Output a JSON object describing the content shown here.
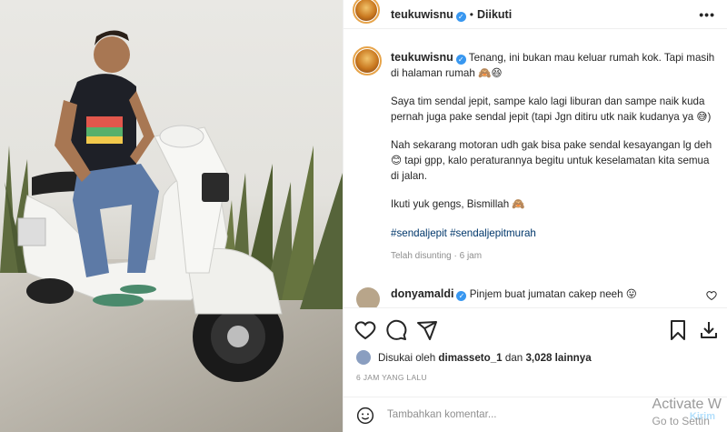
{
  "header": {
    "username": "teukuwisnu",
    "separator": "•",
    "follow_status": "Diikuti",
    "more_icon": "more-horizontal-icon"
  },
  "caption": {
    "username": "teukuwisnu",
    "paragraphs": [
      "Tenang, ini bukan mau keluar rumah kok. Tapi masih di halaman rumah 🙈😆",
      "Saya tim sendal jepit, sampe kalo lagi liburan dan sampe naik kuda pernah juga pake sendal jepit (tapi Jgn ditiru utk naik kudanya ya 😅)",
      "Nah sekarang motoran udh gak bisa pake sendal kesayangan lg deh 😊 tapi gpp, kalo peraturannya begitu untuk keselamatan kita semua di jalan.",
      "Ikuti yuk gengs, Bismillah 🙈"
    ],
    "hashtags": "#sendaljepit #sendaljepitmurah",
    "time": "Telah disunting · 6 jam"
  },
  "comment": {
    "username": "donyamaldi",
    "text": "Pinjem buat jumatan cakep neeh 😛"
  },
  "actions": {
    "like_icon": "heart-icon",
    "comment_icon": "comment-icon",
    "share_icon": "share-icon",
    "save_icon": "bookmark-icon",
    "download_icon": "download-icon"
  },
  "likes": {
    "prefix": "Disukai oleh",
    "user": "dimasseto_1",
    "middle": "dan",
    "count": "3,028 lainnya"
  },
  "posted_ago": "6 JAM YANG LALU",
  "add_comment": {
    "placeholder": "Tambahkan komentar...",
    "post_label": "Kirim"
  },
  "watermark": {
    "line1": "Activate W",
    "line2": "Go to Settin"
  }
}
